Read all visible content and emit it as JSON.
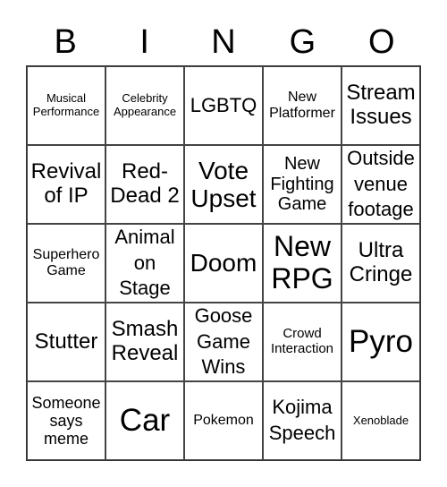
{
  "header": {
    "letters": [
      "B",
      "I",
      "N",
      "G",
      "O"
    ]
  },
  "cells": [
    [
      "Musical Performance",
      "Celebrity Appearance",
      "LGBTQ",
      "New Platformer",
      "Stream Issues"
    ],
    [
      "Revival of IP",
      "Red-Dead 2",
      "Vote Upset",
      "New Fighting Game",
      "Outside venue footage"
    ],
    [
      "Superhero Game",
      "Animal on Stage",
      "Doom",
      "New RPG",
      "Ultra Cringe"
    ],
    [
      "Stutter",
      "Smash Reveal",
      "Goose Game Wins",
      "Crowd Interaction",
      "Pyro"
    ],
    [
      "Someone says meme",
      "Car",
      "Pokemon",
      "Kojima Speech",
      "Xenoblade"
    ]
  ]
}
